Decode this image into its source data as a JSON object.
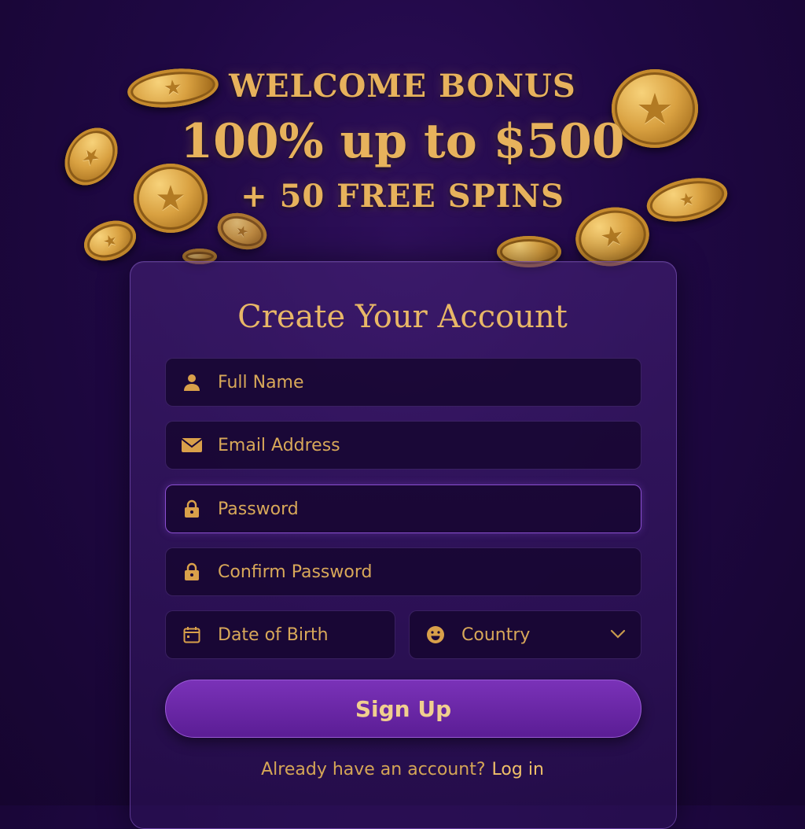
{
  "hero": {
    "line1": "WELCOME BONUS",
    "line2": "100% up to $500",
    "line3": "+ 50 FREE SPINS"
  },
  "form": {
    "title": "Create Your Account",
    "full_name_placeholder": "Full Name",
    "email_placeholder": "Email Address",
    "password_placeholder": "Password",
    "confirm_password_placeholder": "Confirm Password",
    "dob_placeholder": "Date of Birth",
    "country_placeholder": "Country",
    "submit_label": "Sign Up",
    "login_prompt": "Already have an account?",
    "login_link": "Log in"
  },
  "colors": {
    "background": "#1f0844",
    "accent_gold": "#e7b25c",
    "button_purple": "#6a26a8",
    "active_border": "#8a4fd0"
  },
  "icons": [
    "user-icon",
    "envelope-icon",
    "lock-icon",
    "lock-icon",
    "calendar-icon",
    "smiley-icon",
    "chevron-down-icon",
    "star-icon"
  ]
}
